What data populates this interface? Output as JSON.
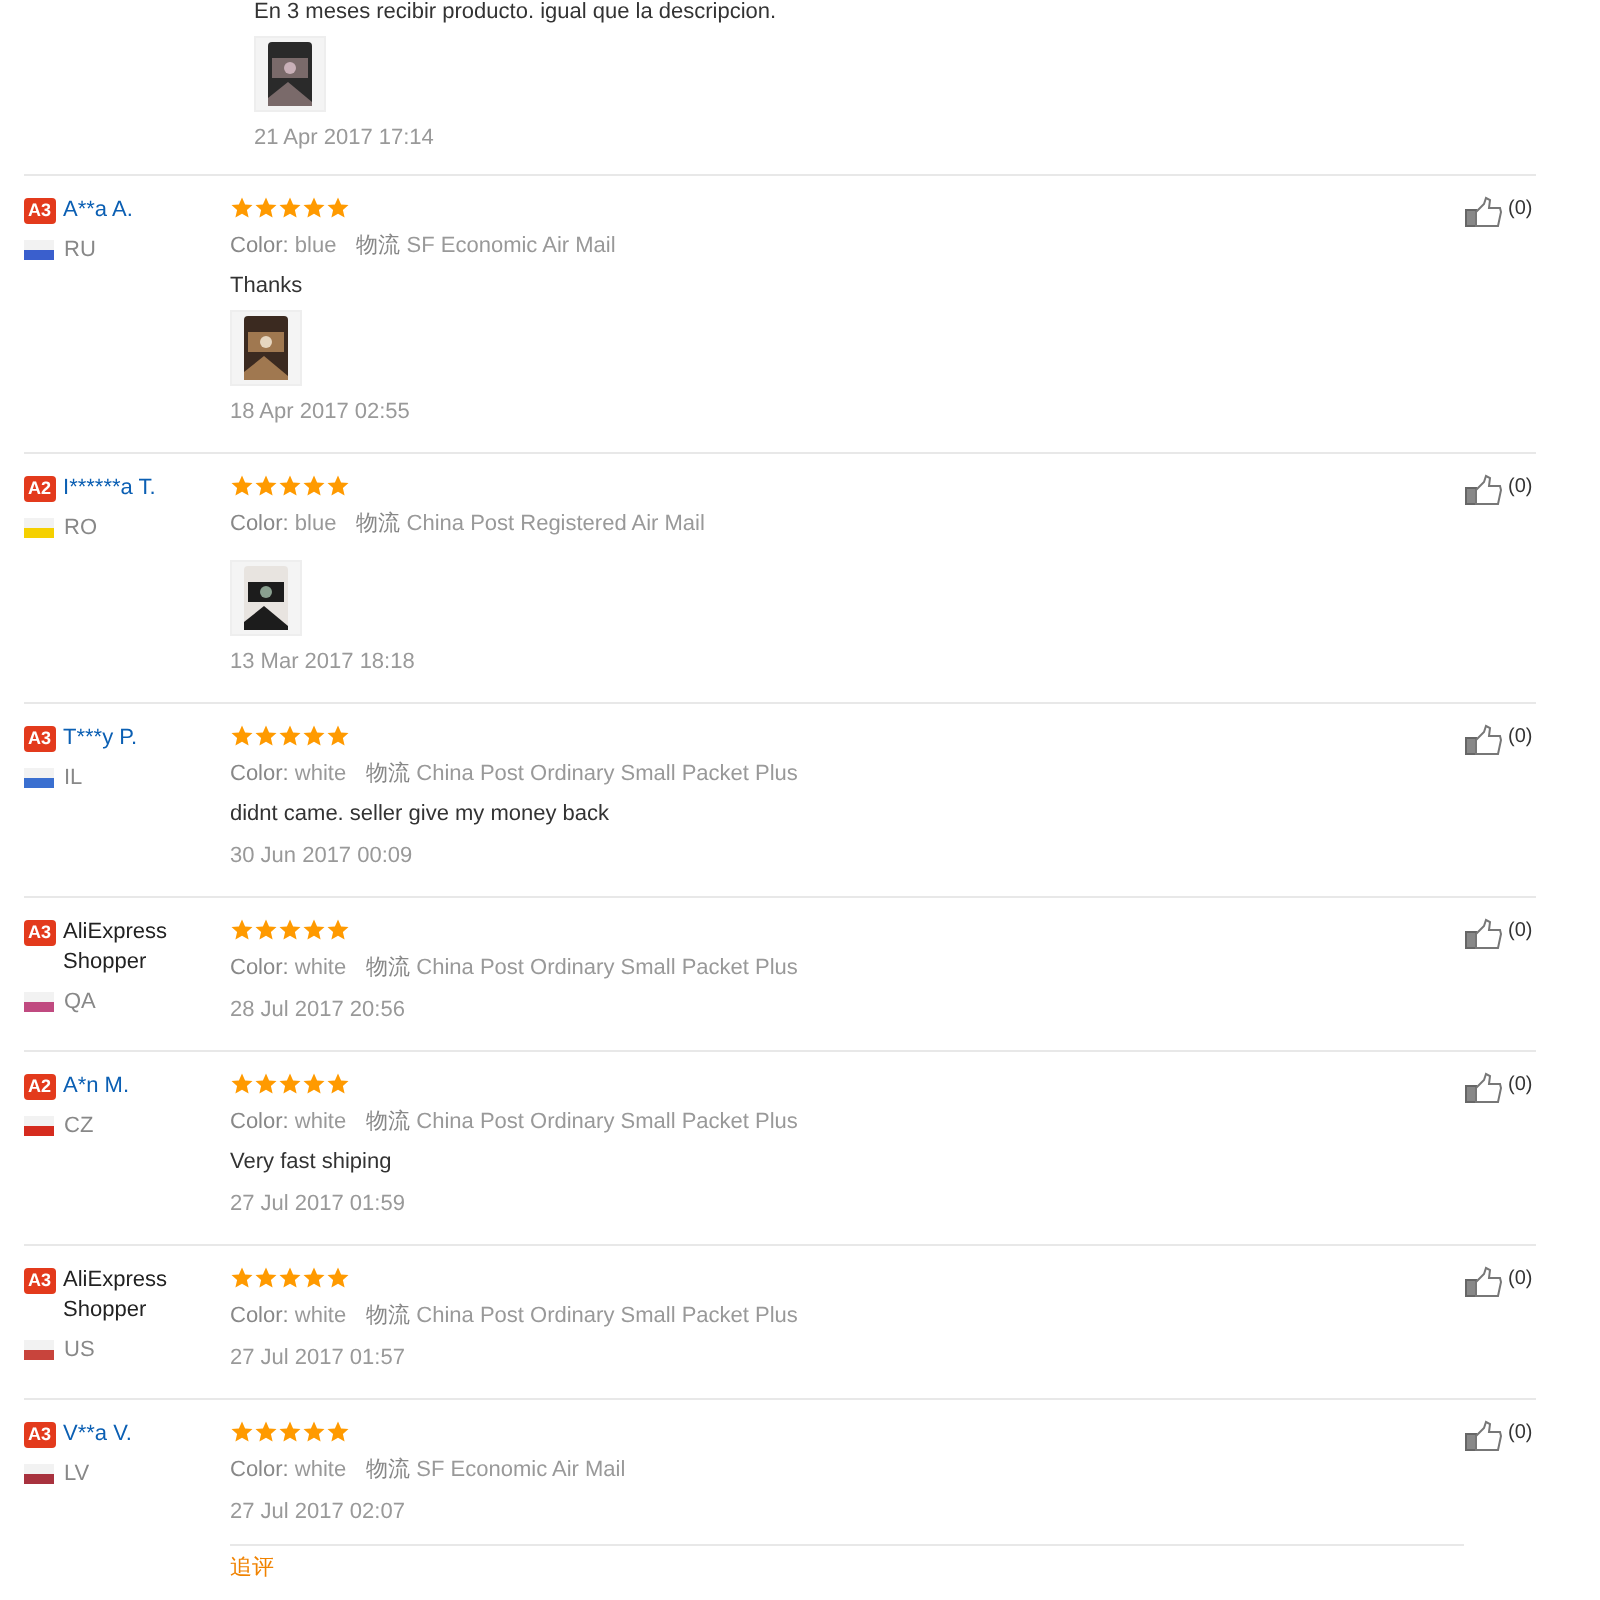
{
  "top_review": {
    "text": "En 3 meses recibir producto. igual que la descripcion.",
    "date": "21 Apr 2017 17:14"
  },
  "reviews": [
    {
      "badge": "A3",
      "name": "A**a A.",
      "country": "RU",
      "flag": {
        "color": "#3a5fcd"
      },
      "stars": 5,
      "color_label": "Color:",
      "product_color": "blue",
      "shipping_label": "物流",
      "shipping": "SF Economic Air Mail",
      "text": "Thanks",
      "date": "18 Apr 2017 02:55",
      "likes": "(0)"
    },
    {
      "badge": "A2",
      "name": "I******a T.",
      "country": "RO",
      "flag": {
        "color": "#f5d000"
      },
      "stars": 5,
      "color_label": "Color:",
      "product_color": "blue",
      "shipping_label": "物流",
      "shipping": "China Post Registered Air Mail",
      "date": "13 Mar 2017 18:18",
      "likes": "(0)"
    },
    {
      "badge": "A3",
      "name": "T***y P.",
      "country": "IL",
      "flag": {
        "color": "#3a6fd0"
      },
      "stars": 5,
      "color_label": "Color:",
      "product_color": "white",
      "shipping_label": "物流",
      "shipping": "China Post Ordinary Small Packet Plus",
      "text": "didnt came. seller give my money back",
      "date": "30 Jun 2017 00:09",
      "likes": "(0)"
    },
    {
      "badge": "A3",
      "name": "AliExpress Shopper",
      "country": "QA",
      "flag": {
        "color": "#c04a80"
      },
      "stars": 5,
      "color_label": "Color:",
      "product_color": "white",
      "shipping_label": "物流",
      "shipping": "China Post Ordinary Small Packet Plus",
      "date": "28 Jul 2017 20:56",
      "likes": "(0)"
    },
    {
      "badge": "A2",
      "name": "A*n M.",
      "country": "CZ",
      "flag": {
        "color": "#d52b1e"
      },
      "stars": 5,
      "color_label": "Color:",
      "product_color": "white",
      "shipping_label": "物流",
      "shipping": "China Post Ordinary Small Packet Plus",
      "text": "Very fast shiping",
      "date": "27 Jul 2017 01:59",
      "likes": "(0)"
    },
    {
      "badge": "A3",
      "name": "AliExpress Shopper",
      "country": "US",
      "flag": {
        "color": "#c8443c"
      },
      "stars": 5,
      "color_label": "Color:",
      "product_color": "white",
      "shipping_label": "物流",
      "shipping": "China Post Ordinary Small Packet Plus",
      "date": "27 Jul 2017 01:57",
      "likes": "(0)"
    },
    {
      "badge": "A3",
      "name": "V**a V.",
      "country": "LV",
      "flag": {
        "color": "#a8323e"
      },
      "stars": 5,
      "color_label": "Color:",
      "product_color": "white",
      "shipping_label": "物流",
      "shipping": "SF Economic Air Mail",
      "date": "27 Jul 2017 02:07",
      "likes": "(0)",
      "follow_up_label": "追评"
    }
  ]
}
